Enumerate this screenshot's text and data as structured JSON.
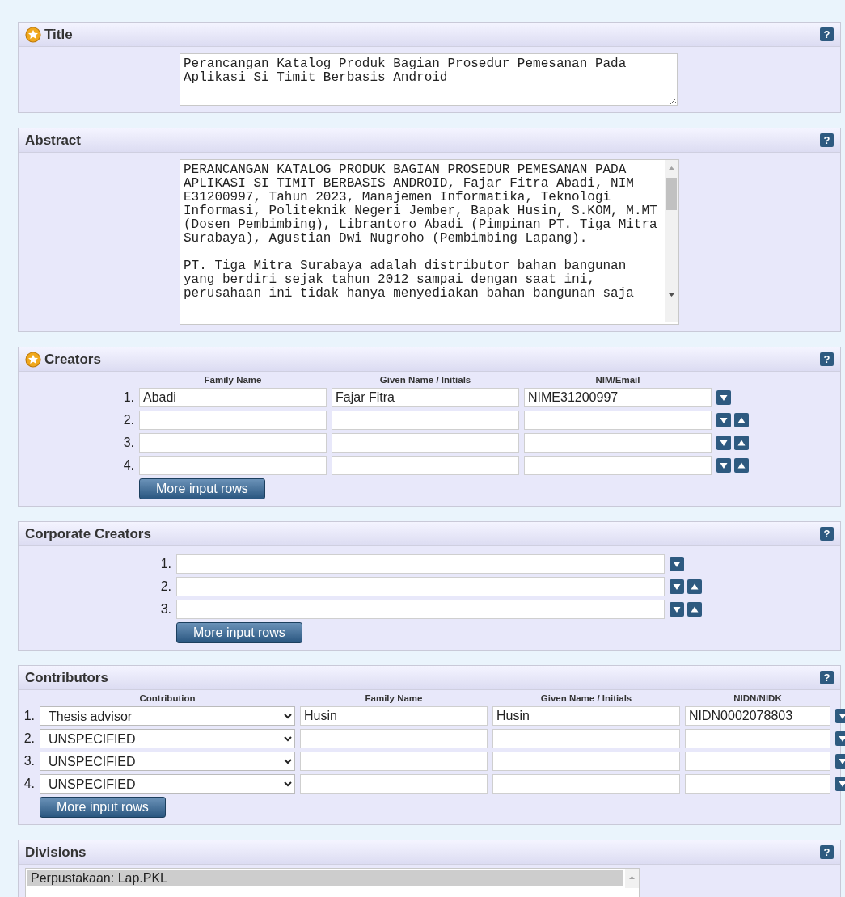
{
  "sections": [
    {
      "kind": "title",
      "heading": "Title",
      "required": true,
      "help": "?",
      "value": "Perancangan Katalog Produk Bagian Prosedur Pemesanan Pada Aplikasi Si Timit Berbasis Android"
    },
    {
      "kind": "abstract",
      "heading": "Abstract",
      "required": false,
      "help": "?",
      "value": "PERANCANGAN KATALOG PRODUK BAGIAN PROSEDUR PEMESANAN PADA APLIKASI SI TIMIT BERBASIS ANDROID, Fajar Fitra Abadi, NIM E31200997, Tahun 2023, Manajemen Informatika, Teknologi Informasi, Politeknik Negeri Jember, Bapak Husin, S.KOM, M.MT (Dosen Pembimbing), Librantoro Abadi (Pimpinan PT. Tiga Mitra Surabaya), Agustian Dwi Nugroho (Pembimbing Lapang).\n\nPT. Tiga Mitra Surabaya adalah distributor bahan bangunan yang berdiri sejak tahun 2012 sampai dengan saat ini, perusahaan ini tidak hanya menyediakan bahan bangunan saja"
    },
    {
      "kind": "names",
      "heading": "Creators",
      "required": true,
      "help": "?",
      "columns": [
        "Family Name",
        "Given Name / Initials",
        "NIM/Email"
      ],
      "rows": [
        {
          "number": "1.",
          "values": [
            "Abadi",
            "Fajar Fitra",
            "NIME31200997"
          ]
        },
        {
          "number": "2."
        },
        {
          "number": "3."
        },
        {
          "number": "4."
        }
      ],
      "more_button": "More input rows"
    },
    {
      "kind": "single",
      "heading": "Corporate Creators",
      "required": false,
      "help": "?",
      "rows": [
        {
          "number": "1."
        },
        {
          "number": "2."
        },
        {
          "number": "3."
        }
      ],
      "more_button": "More input rows"
    },
    {
      "kind": "contributors",
      "heading": "Contributors",
      "required": false,
      "help": "?",
      "columns": [
        "Contribution",
        "Family Name",
        "Given Name / Initials",
        "NIDN/NIDK"
      ],
      "rows": [
        {
          "number": "1.",
          "contribution": "Thesis advisor",
          "values": [
            "Husin",
            "Husin",
            "NIDN0002078803"
          ]
        },
        {
          "number": "2.",
          "contribution": "UNSPECIFIED"
        },
        {
          "number": "3.",
          "contribution": "UNSPECIFIED"
        },
        {
          "number": "4.",
          "contribution": "UNSPECIFIED"
        }
      ],
      "more_button": "More input rows"
    },
    {
      "kind": "divisions",
      "heading": "Divisions",
      "required": false,
      "help": "?",
      "items": [
        {
          "label": "Perpustakaan: Lap.PKL",
          "selected": true
        }
      ]
    }
  ]
}
